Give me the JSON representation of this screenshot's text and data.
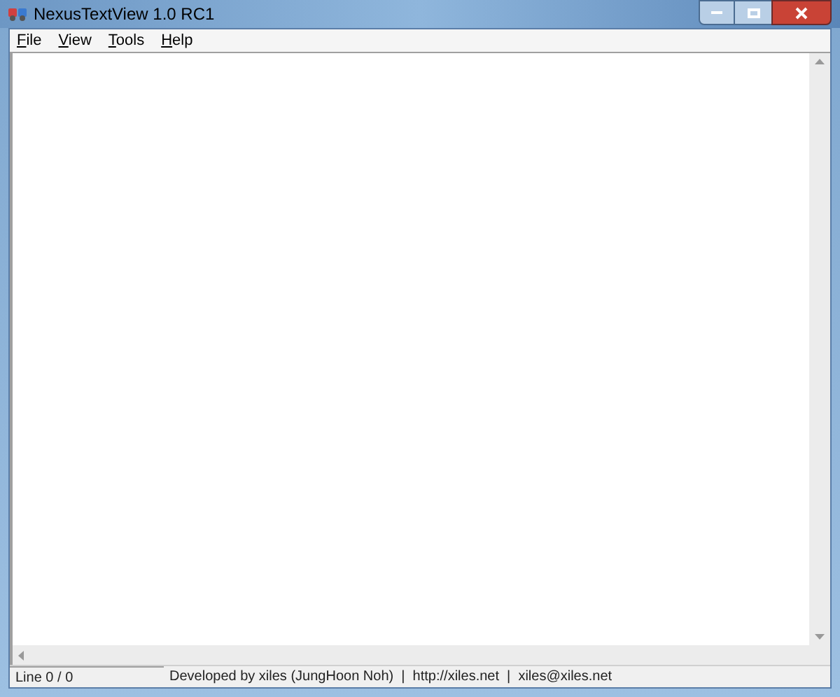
{
  "window": {
    "title": "NexusTextView 1.0 RC1"
  },
  "menu": [
    "File",
    "View",
    "Tools",
    "Help"
  ],
  "status_bar": {
    "line": "Line 0 / 0",
    "info": "Developed by xiles (JungHoon Noh)  |  http://xiles.net  |  xiles@xiles.net"
  }
}
